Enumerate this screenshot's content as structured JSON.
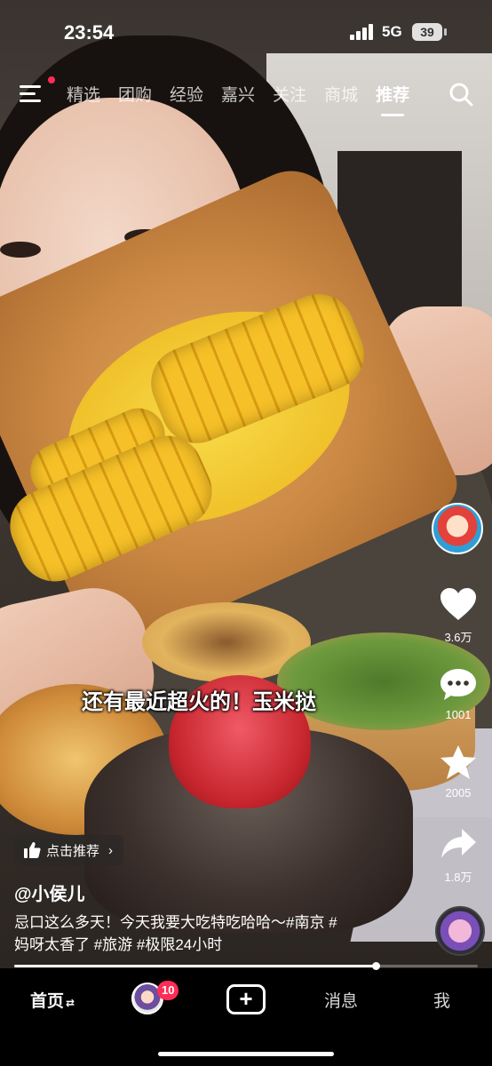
{
  "status_bar": {
    "time": "23:54",
    "network": "5G",
    "battery": "39"
  },
  "top_nav": {
    "tabs": [
      {
        "label": "精选",
        "active": false
      },
      {
        "label": "团购",
        "active": false
      },
      {
        "label": "经验",
        "active": false
      },
      {
        "label": "嘉兴",
        "active": false
      },
      {
        "label": "关注",
        "active": false
      },
      {
        "label": "商城",
        "active": false
      },
      {
        "label": "推荐",
        "active": true
      }
    ],
    "menu_icon": "menu-icon",
    "search_icon": "search-icon",
    "notification_dot_color": "#ff2d55"
  },
  "video": {
    "subtitle": "还有最近超火的！玉米挞",
    "progress": 0.78
  },
  "right_rail": {
    "like_count": "3.6万",
    "comment_count": "1001",
    "favorite_count": "2005",
    "share_count": "1.8万"
  },
  "post": {
    "recommend_label": "点击推荐",
    "author": "@小侯儿",
    "description_lines": [
      "忌口这么多天！今天我要大吃特吃哈哈～#南京 #",
      "妈呀太香了 #旅游 #极限24小时"
    ]
  },
  "tab_bar": {
    "home": "首页",
    "friends_badge": "10",
    "messages": "消息",
    "me": "我"
  },
  "colors": {
    "accent": "#ff2d55",
    "text": "#ffffff",
    "tab_bar_bg": "#000000"
  }
}
